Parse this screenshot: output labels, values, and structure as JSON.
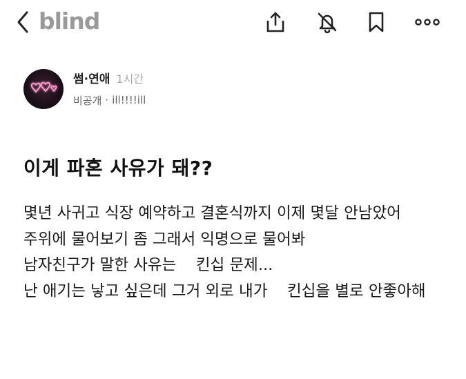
{
  "app": {
    "logo_text": "blind"
  },
  "author": {
    "topic": "썸·연애",
    "time": "1시간",
    "visibility": "비공개",
    "separator": "·",
    "nickname": "ill!!!!ill"
  },
  "post": {
    "title": "이게 파혼 사유가 돼??",
    "body": "몇년 사귀고 식장 예약하고 결혼식까지 이제 몇달 안남았어\n주위에 물어보기 좀 그래서 익명으로 물어봐\n남자친구가 말한 사유는    킨십 문제...\n난 애기는 낳고 싶은데 그거 외로 내가    킨십을 별로 안좋아해"
  },
  "icons": {
    "back": "chevron-left-icon",
    "share": "share-icon",
    "mute": "bell-off-icon",
    "bookmark": "bookmark-icon",
    "more": "more-dots-icon"
  },
  "colors": {
    "logo": "#9a9a9a",
    "avatar_neon": "#ff8fc8"
  }
}
